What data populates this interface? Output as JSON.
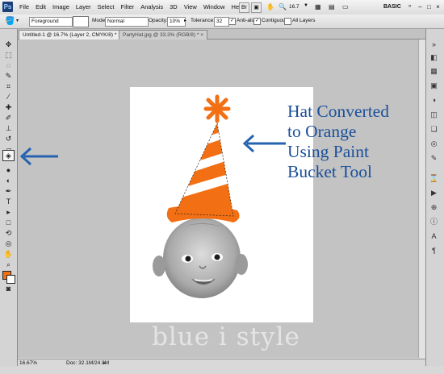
{
  "app": {
    "logo": "Ps"
  },
  "menu": {
    "items": [
      "File",
      "Edit",
      "Image",
      "Layer",
      "Select",
      "Filter",
      "Analysis",
      "3D",
      "View",
      "Window",
      "Help"
    ],
    "zoom_value": "16.7",
    "workspace": "BASIC"
  },
  "options": {
    "fill_source": "Foreground",
    "mode_label": "Mode:",
    "mode_value": "Normal",
    "opacity_label": "Opacity:",
    "opacity_value": "10%",
    "tolerance_label": "Tolerance:",
    "tolerance_value": "32",
    "anti_alias_label": "Anti-alias",
    "anti_alias_checked": true,
    "contiguous_label": "Contiguous",
    "contiguous_checked": true,
    "all_layers_label": "All Layers",
    "all_layers_checked": false
  },
  "tabs": [
    {
      "label": "Untitled-1 @ 16.7% (Layer 2, CMYK/8) *",
      "close": "×",
      "active": true
    },
    {
      "label": "PartyHat.jpg @ 33.3% (RGB/8) *",
      "close": "×",
      "active": false
    }
  ],
  "status": {
    "zoom": "16.67%",
    "doc": "Doc: 32.1M/24.9M"
  },
  "annotation": {
    "lines": [
      "Hat Converted",
      "to Orange",
      "Using Paint",
      "Bucket Tool"
    ]
  },
  "watermark": "blue i style",
  "colors": {
    "foreground": "#f26f13",
    "background": "#ffffff",
    "annotation_text": "#1a4f9a",
    "arrow": "#2563b0"
  }
}
